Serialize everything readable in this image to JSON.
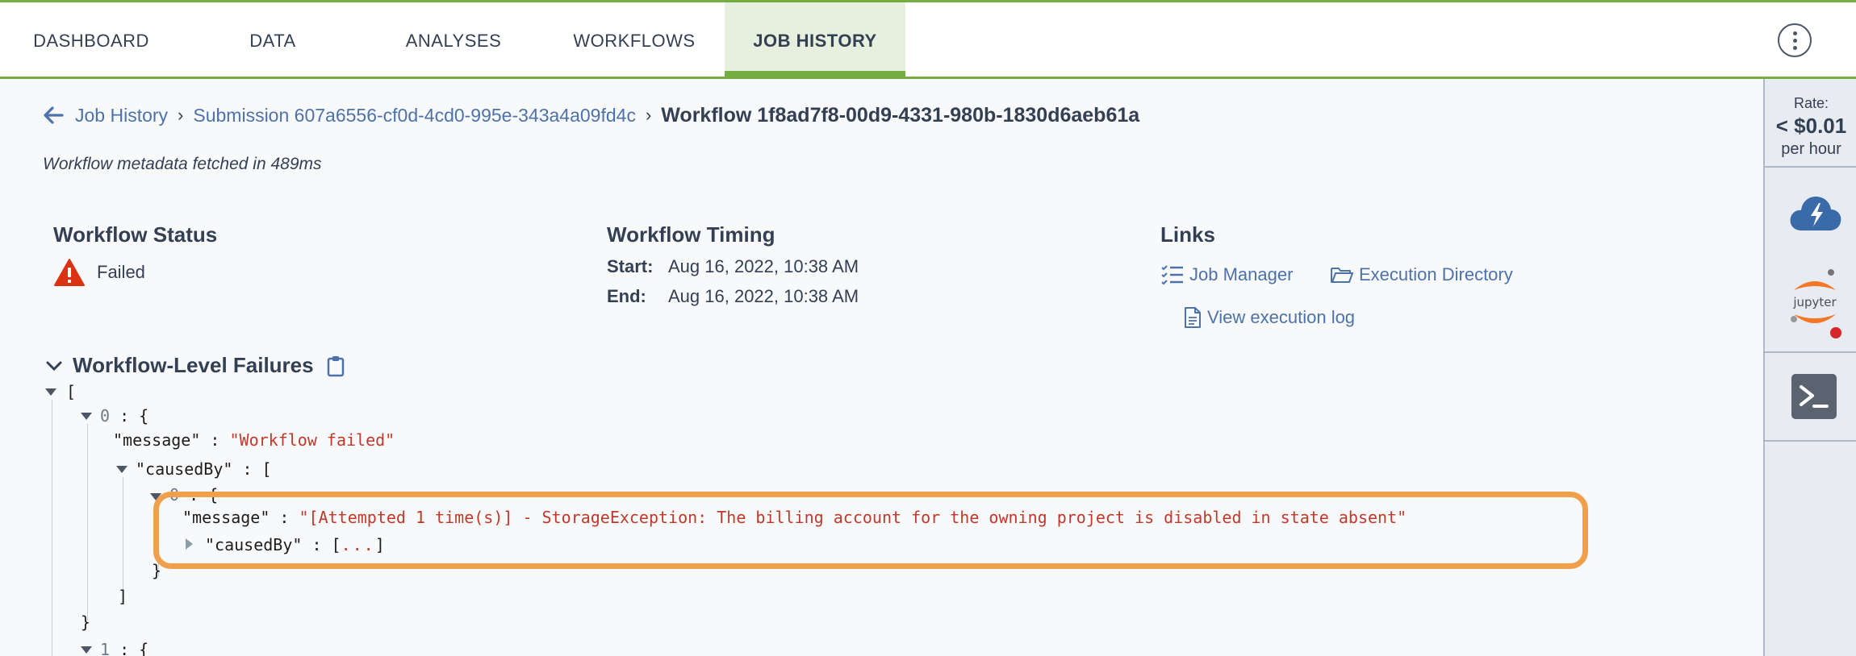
{
  "nav": {
    "tabs": [
      {
        "label": "DASHBOARD"
      },
      {
        "label": "DATA"
      },
      {
        "label": "ANALYSES"
      },
      {
        "label": "WORKFLOWS"
      },
      {
        "label": "JOB HISTORY",
        "active": true
      }
    ],
    "menu_icon": "kebab-menu-icon"
  },
  "rail": {
    "rate_label": "Rate:",
    "rate_value": "< $0.01",
    "rate_unit": "per hour",
    "cloud_icon": "cloud-lightning-icon",
    "jupyter_text": "jupyter",
    "terminal_icon": "terminal-icon"
  },
  "breadcrumb": {
    "back_icon": "arrow-left-icon",
    "job_history": "Job History",
    "submission": "Submission 607a6556-cf0d-4cd0-995e-343a4a09fd4c",
    "separator": "›",
    "workflow": "Workflow 1f8ad7f8-00d9-4331-980b-1830d6aeb61a"
  },
  "fetch_note": "Workflow metadata fetched in 489ms",
  "status": {
    "title": "Workflow Status",
    "value": "Failed",
    "icon": "warning-triangle-icon"
  },
  "timing": {
    "title": "Workflow Timing",
    "start_label": "Start:",
    "start_value": "Aug 16, 2022, 10:38 AM",
    "end_label": "End:",
    "end_value": "Aug 16, 2022, 10:38 AM"
  },
  "links": {
    "title": "Links",
    "job_manager": "Job Manager",
    "execution_directory": "Execution Directory",
    "view_log": "View execution log"
  },
  "failures": {
    "title": "Workflow-Level Failures",
    "copy_icon": "clipboard-icon",
    "lines": {
      "open_bracket": "[",
      "idx0": "0",
      "colon_brace": " : {",
      "msg_key": "\"message\"",
      "msg_sep": " : ",
      "msg_val": "\"Workflow failed\"",
      "caused_key": "\"causedBy\"",
      "caused_sep": " : [",
      "inner_idx": "0",
      "inner_colon_brace": " : {",
      "inner_msg_key": "\"message\"",
      "inner_msg_sep": " : ",
      "inner_msg_val": "\"[Attempted 1 time(s)] - StorageException: The billing account for the owning project is disabled in state absent\"",
      "inner_caused_key": "\"causedBy\"",
      "inner_caused_sep": " : [",
      "ellipsis": "...",
      "inner_close_bracket": "]",
      "inner_close_brace": "}",
      "close_bracket": "]",
      "close_brace": "}",
      "idx1": "1",
      "colon_brace_1": " : {"
    }
  }
}
